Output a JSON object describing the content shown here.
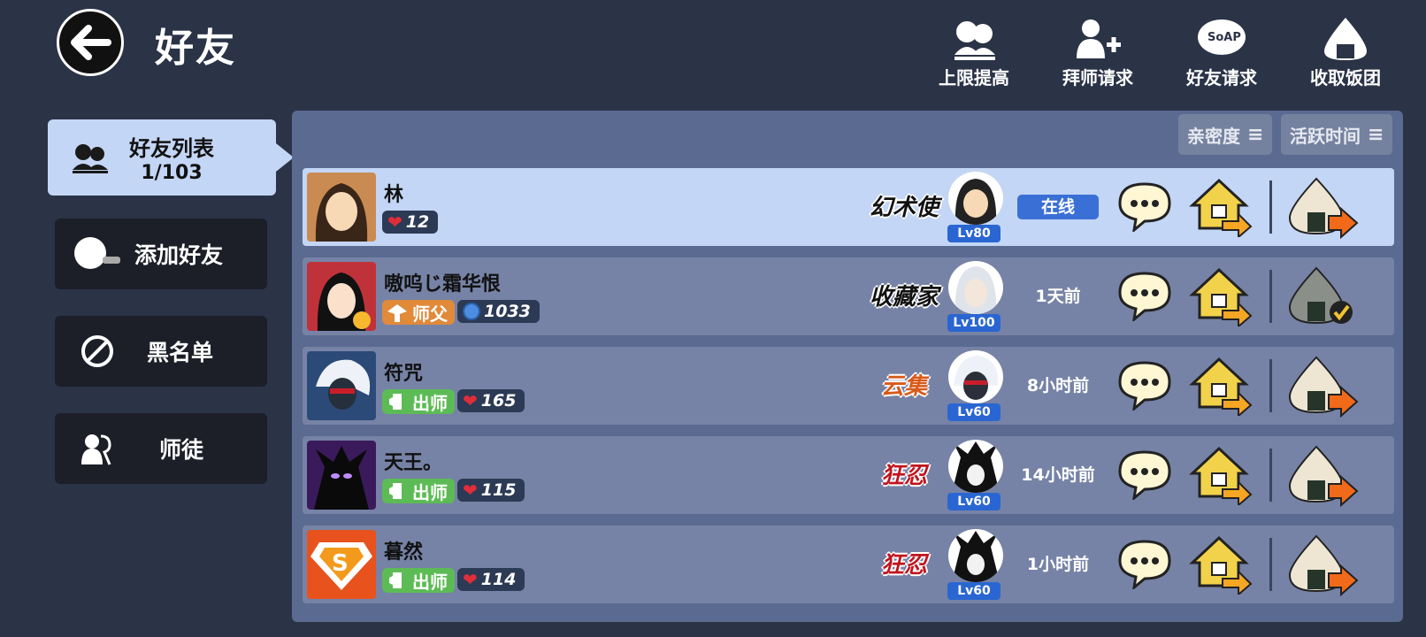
{
  "header": {
    "title": "好友",
    "actions": [
      {
        "label": "上限提高",
        "icon": "group-up-icon"
      },
      {
        "label": "拜师请求",
        "icon": "add-mentor-icon"
      },
      {
        "label": "好友请求",
        "icon": "soap-bubble-icon"
      },
      {
        "label": "收取饭团",
        "icon": "rice-ball-icon"
      }
    ]
  },
  "sidebar": {
    "active": {
      "label": "好友列表",
      "count": "1/103"
    },
    "items": [
      {
        "label": "添加好友",
        "icon": "add-friend-icon"
      },
      {
        "label": "黑名单",
        "icon": "block-icon"
      },
      {
        "label": "师徒",
        "icon": "mentor-icon"
      }
    ]
  },
  "sort": {
    "affinity": "亲密度",
    "active_time": "活跃时间"
  },
  "friends": [
    {
      "name": "林",
      "relation": "",
      "stat": "12",
      "stat_icon": "heart",
      "title": "幻术使",
      "level": "Lv80",
      "status": "在线",
      "online": true,
      "rice_collected": false
    },
    {
      "name": "嗷呜じ霜华恨",
      "relation": "师父",
      "stat": "1033",
      "stat_icon": "coin",
      "title": "收藏家",
      "level": "Lv100",
      "status": "1天前",
      "online": false,
      "rice_collected": true
    },
    {
      "name": "符咒",
      "relation": "出师",
      "stat": "165",
      "stat_icon": "heart",
      "title": "云集",
      "level": "Lv60",
      "status": "8小时前",
      "online": false,
      "rice_collected": false
    },
    {
      "name": "天王。",
      "relation": "出师",
      "stat": "115",
      "stat_icon": "heart",
      "title": "狂忍",
      "level": "Lv60",
      "status": "14小时前",
      "online": false,
      "rice_collected": false
    },
    {
      "name": "暮然",
      "relation": "出师",
      "stat": "114",
      "stat_icon": "heart",
      "title": "狂忍",
      "level": "Lv60",
      "status": "1小时前",
      "online": false,
      "rice_collected": false
    }
  ],
  "colors": {
    "background": "#2b3347",
    "panel": "#5b6a91",
    "row": "#7683a6",
    "highlight": "#c4d6f5",
    "online": "#3a6fd6",
    "level": "#2a66d1"
  }
}
